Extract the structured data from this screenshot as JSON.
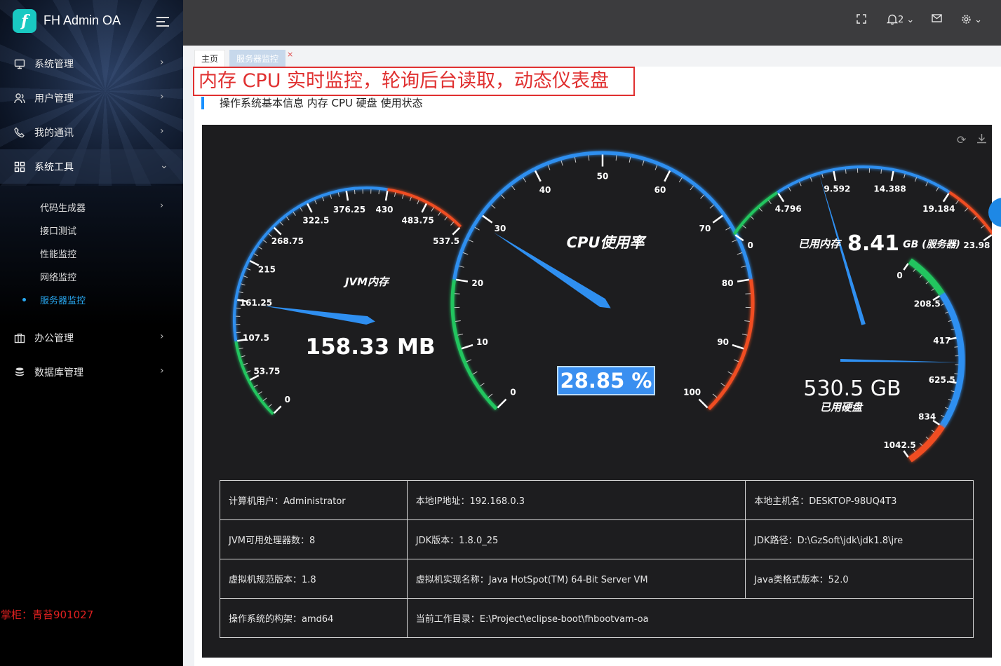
{
  "app": {
    "title": "FH Admin OA",
    "logo_letter": "f"
  },
  "sidebar": {
    "items": [
      {
        "label": "系统管理",
        "icon": "monitor-icon"
      },
      {
        "label": "用户管理",
        "icon": "users-icon"
      },
      {
        "label": "我的通讯",
        "icon": "phone-icon"
      },
      {
        "label": "系统工具",
        "icon": "grid-icon",
        "open": true
      },
      {
        "label": "办公管理",
        "icon": "briefcase-icon"
      },
      {
        "label": "数据库管理",
        "icon": "database-icon"
      }
    ],
    "subitems": [
      {
        "label": "代码生成器",
        "has_children": true
      },
      {
        "label": "接口测试"
      },
      {
        "label": "性能监控"
      },
      {
        "label": "网络监控"
      },
      {
        "label": "服务器监控",
        "active": true
      }
    ],
    "watermark": "掌柜：青苔901027"
  },
  "header": {
    "notification_count": "2"
  },
  "tabs": [
    {
      "label": "主页"
    },
    {
      "label": "服务器监控",
      "active": true
    }
  ],
  "banner": "内存 CPU 实时监控，轮询后台读取，动态仪表盘",
  "section_title": "操作系统基本信息 内存 CPU 硬盘 使用状态",
  "gauges": {
    "jvm": {
      "title": "JVM内存",
      "min": 0,
      "max": 537.5,
      "value": 158.33,
      "value_text": "158.33 MB",
      "ticks": [
        "0",
        "53.75",
        "107.5",
        "161.25",
        "215",
        "268.75",
        "322.5",
        "376.25",
        "430",
        "483.75",
        "537.5"
      ]
    },
    "cpu": {
      "title": "CPU使用率",
      "min": 0,
      "max": 100,
      "value": 28.85,
      "value_text": "28.85 %",
      "ticks": [
        "0",
        "10",
        "20",
        "30",
        "40",
        "50",
        "60",
        "70",
        "80",
        "90",
        "100"
      ]
    },
    "memory": {
      "title": "已用内存",
      "min": 0,
      "max": 23.98,
      "value": 8.41,
      "value_text": "8.41",
      "unit": "GB (服务器)",
      "ticks": [
        "0",
        "4.796",
        "9.592",
        "14.388",
        "19.184",
        "23.98"
      ]
    },
    "disk": {
      "title": "已用硬盘",
      "min": 0,
      "max": 1042.5,
      "value": 530.5,
      "value_text": "530.5 GB",
      "ticks": [
        "0",
        "208.5",
        "417",
        "625.5",
        "834",
        "1042.5"
      ]
    }
  },
  "info_table": {
    "rows": [
      [
        "计算机用户：Administrator",
        "本地IP地址：192.168.0.3",
        "本地主机名：DESKTOP-98UQ4T3"
      ],
      [
        "JVM可用处理器数：8",
        "JDK版本：1.8.0_25",
        "JDK路径：D:\\GzSoft\\jdk\\jdk1.8\\jre"
      ],
      [
        "虚拟机规范版本：1.8",
        "虚拟机实现名称：Java HotSpot(TM) 64-Bit Server VM",
        "Java类格式版本：52.0"
      ],
      [
        "操作系统的构架：amd64",
        "当前工作目录：E:\\Project\\eclipse-boot\\fhbootvam-oa"
      ]
    ]
  },
  "colors": {
    "accent": "#1890ff",
    "gauge_blue": "#2f8ff0",
    "gauge_green": "#22c55e",
    "gauge_red": "#f04e23",
    "banner_red": "#e03030"
  }
}
